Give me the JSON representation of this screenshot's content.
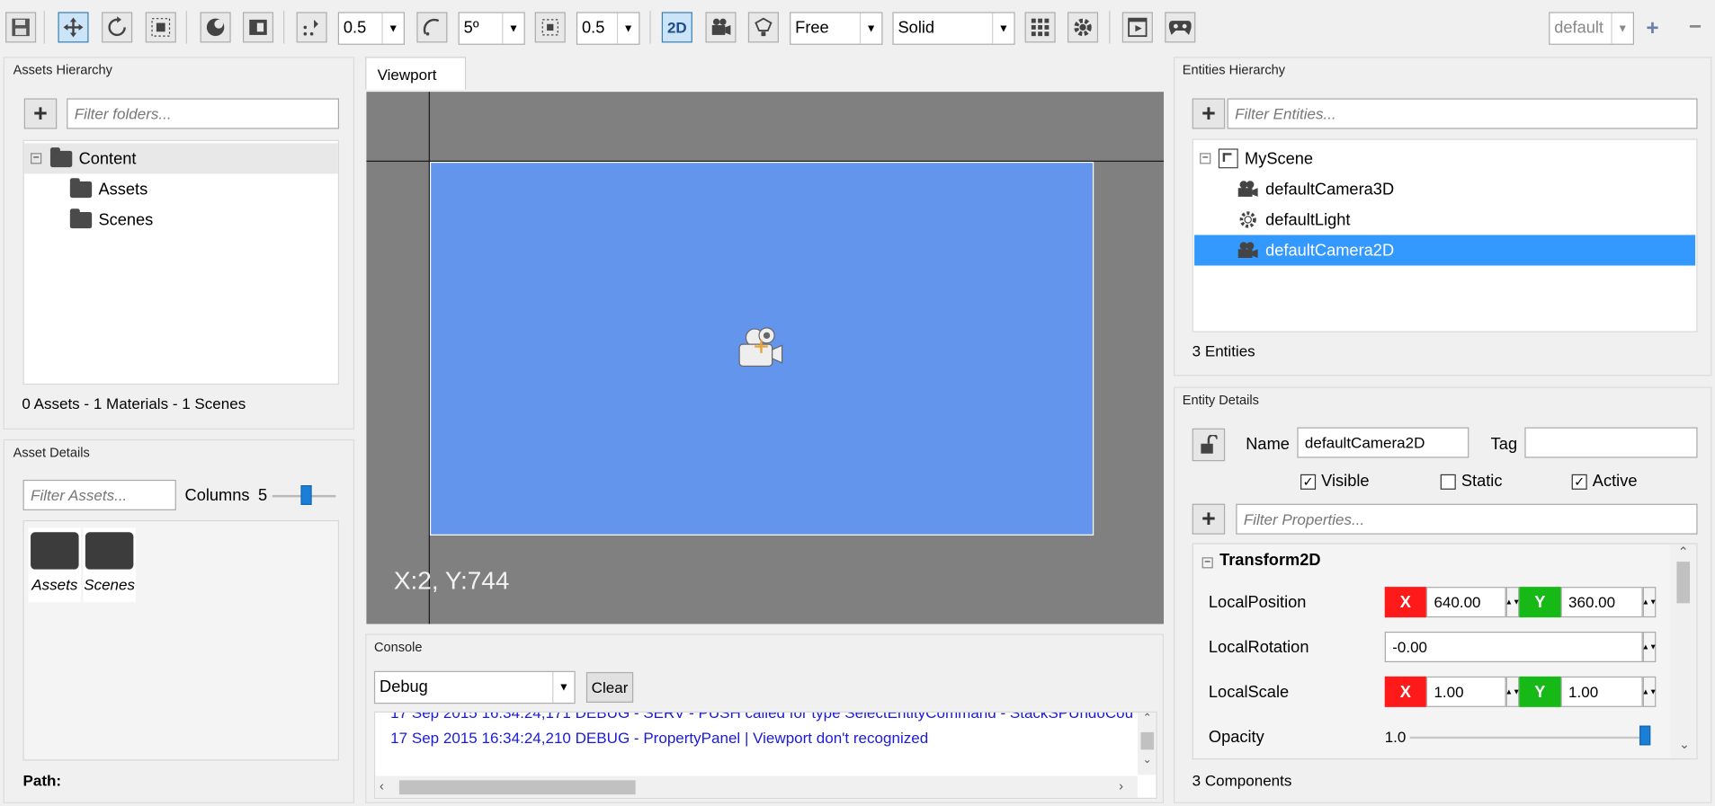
{
  "toolbar": {
    "scale_value": "0.5",
    "rotate_value": "5º",
    "snap_value": "0.5",
    "mode_2d_label": "2D",
    "camera_mode": "Free",
    "render_mode": "Solid",
    "layout_select": "default"
  },
  "assets_hierarchy": {
    "title": "Assets Hierarchy",
    "filter_placeholder": "Filter folders...",
    "root": "Content",
    "children": [
      "Assets",
      "Scenes"
    ],
    "summary": "0 Assets - 1 Materials - 1 Scenes"
  },
  "asset_details": {
    "title": "Asset Details",
    "filter_placeholder": "Filter Assets...",
    "columns_label": "Columns",
    "columns_value": "5",
    "columns_slider": 0.55,
    "items": [
      "Assets",
      "Scenes"
    ],
    "path_label": "Path:"
  },
  "viewport": {
    "tab": "Viewport",
    "coords": "X:2, Y:744"
  },
  "console": {
    "title": "Console",
    "level": "Debug",
    "clear_label": "Clear",
    "partial_line": "17 Sep 2015 16:34:24,171 DEBUG - SERV - PUSH called for type SelectEntityCommand - StackSPUndoCou",
    "line": "17 Sep 2015 16:34:24,210 DEBUG - PropertyPanel | Viewport don't recognized"
  },
  "entities_hierarchy": {
    "title": "Entities Hierarchy",
    "filter_placeholder": "Filter Entities...",
    "scene": "MyScene",
    "entities": [
      "defaultCamera3D",
      "defaultLight",
      "defaultCamera2D"
    ],
    "selected_index": 2,
    "summary": "3 Entities"
  },
  "entity_details": {
    "title": "Entity Details",
    "name_label": "Name",
    "name_value": "defaultCamera2D",
    "tag_label": "Tag",
    "tag_value": "",
    "visible_label": "Visible",
    "visible_checked": true,
    "static_label": "Static",
    "static_checked": false,
    "active_label": "Active",
    "active_checked": true,
    "filter_placeholder": "Filter Properties...",
    "component_title": "Transform2D",
    "local_position_label": "LocalPosition",
    "pos_x_badge": "X",
    "pos_x": "640.00",
    "pos_y_badge": "Y",
    "pos_y": "360.00",
    "local_rotation_label": "LocalRotation",
    "rotation": "-0.00",
    "local_scale_label": "LocalScale",
    "scale_x_badge": "X",
    "scale_x": "1.00",
    "scale_y_badge": "Y",
    "scale_y": "1.00",
    "opacity_label": "Opacity",
    "opacity_value": "1.0",
    "components_summary": "3 Components"
  },
  "colors": {
    "viewport_bg": "#808080",
    "canvas_blue": "#6495ed",
    "selection_blue": "#3399ff",
    "badge_red": "#ff1a1a",
    "badge_green": "#16b916",
    "console_text": "#1a1adc"
  }
}
